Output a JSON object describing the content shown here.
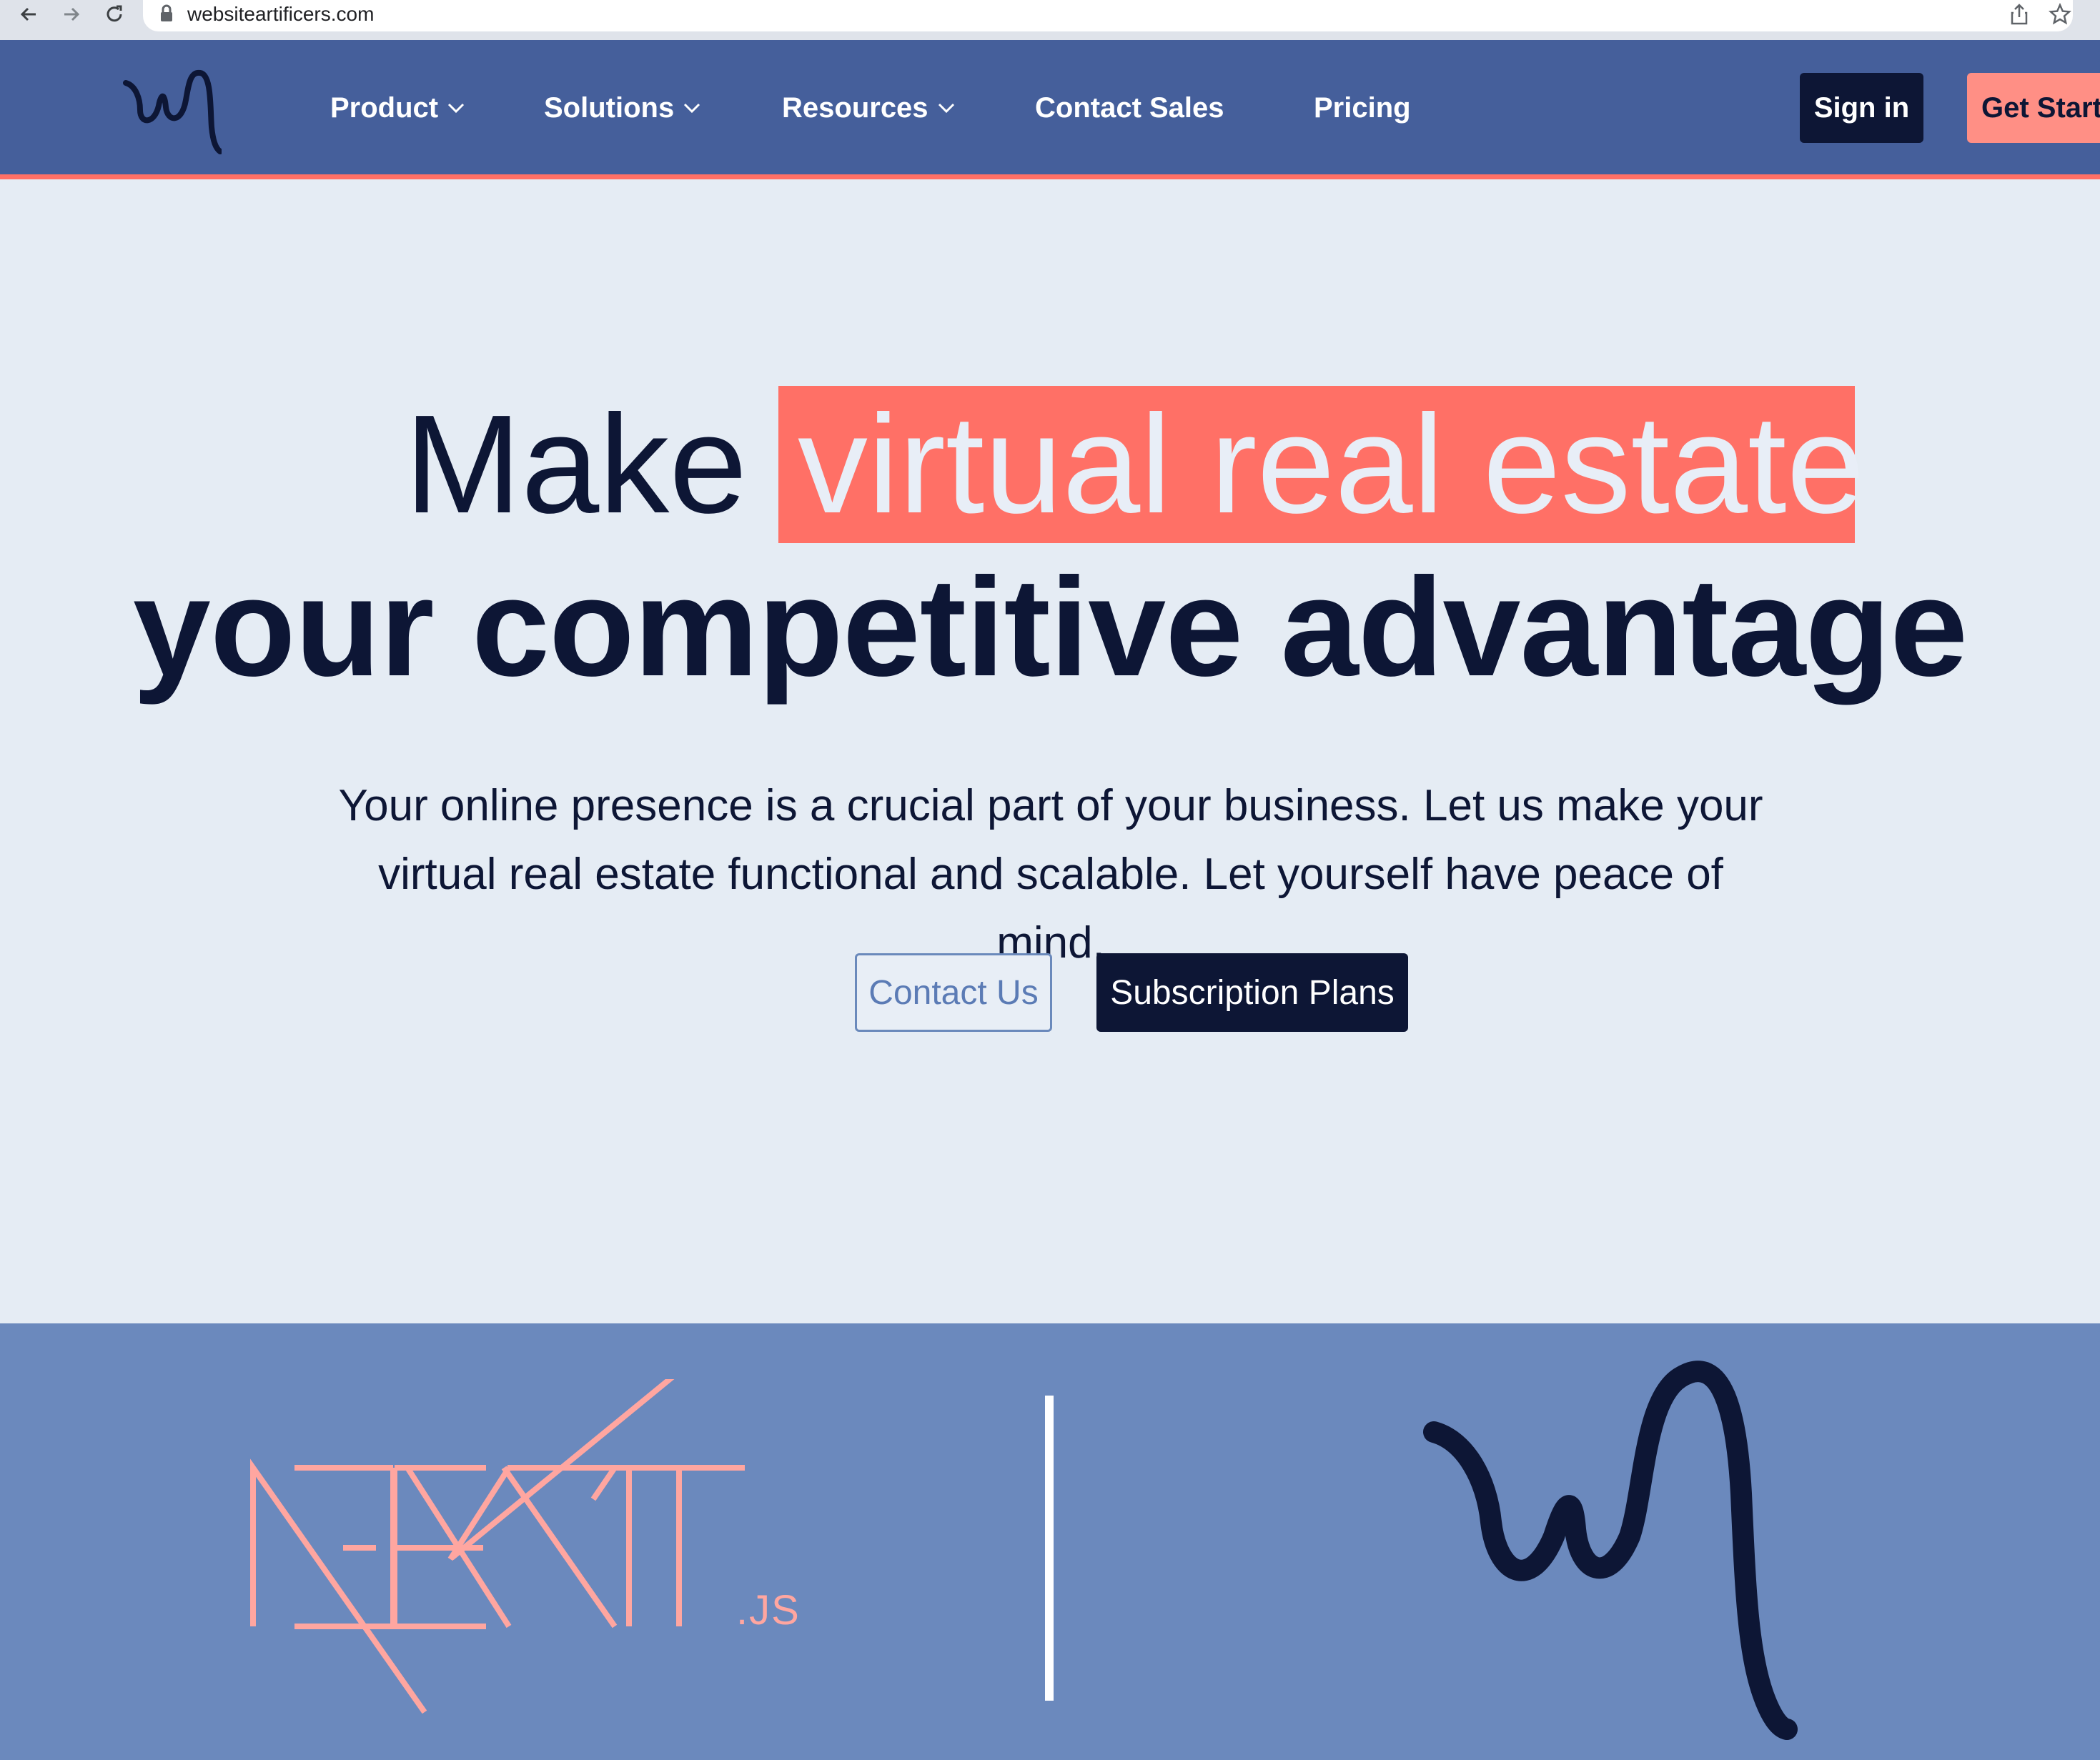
{
  "browser": {
    "url": "websiteartificers.com"
  },
  "header": {
    "nav": [
      {
        "label": "Product",
        "has_dropdown": true
      },
      {
        "label": "Solutions",
        "has_dropdown": true
      },
      {
        "label": "Resources",
        "has_dropdown": true
      },
      {
        "label": "Contact Sales",
        "has_dropdown": false
      },
      {
        "label": "Pricing",
        "has_dropdown": false
      }
    ],
    "sign_in": "Sign in",
    "get_started": "Get Start"
  },
  "hero": {
    "line1_plain": "Make",
    "line1_highlight": "virtual real estate",
    "line2": "your competitive advantage",
    "subtitle": "Your online presence is a crucial part of your business. Let us make your virtual real estate functional and scalable. Let yourself have peace of mind.",
    "contact_button": "Contact Us",
    "plans_button": "Subscription Plans"
  },
  "band": {
    "nextjs_logo": "NEXT.JS"
  },
  "colors": {
    "header_bg": "#455f9b",
    "accent_coral": "#ff7066",
    "navy": "#0d1635",
    "hero_bg": "#e5ecf4",
    "band_bg": "#6b89bd"
  }
}
